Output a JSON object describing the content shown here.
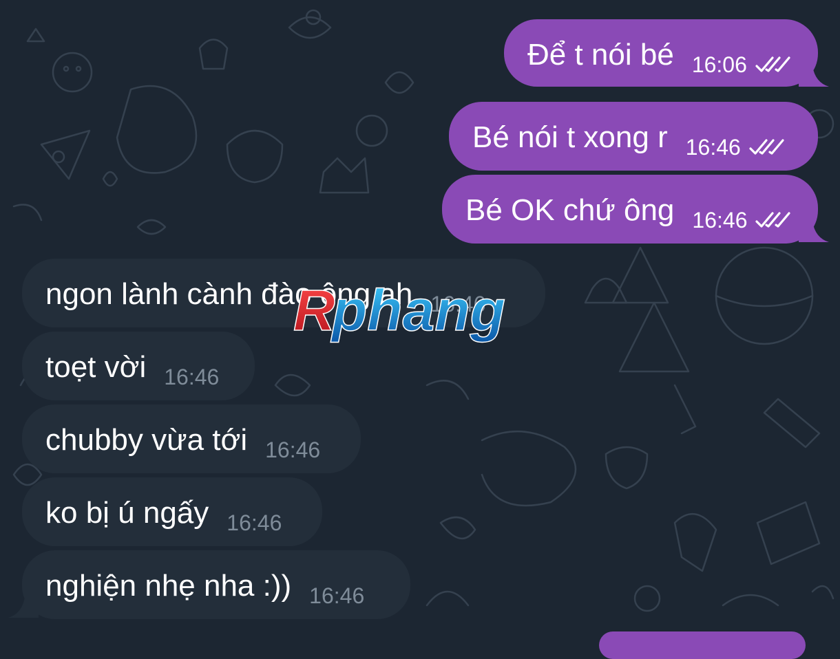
{
  "colors": {
    "background": "#1c2632",
    "outgoing_bubble": "#8a4ab6",
    "incoming_bubble": "#232e3a",
    "incoming_time": "#7f8c99"
  },
  "outgoing": [
    {
      "text": "Để t nói bé",
      "time": "16:06",
      "status": "read-double-check-icon"
    },
    {
      "text": "Bé nói t xong r",
      "time": "16:46",
      "status": "read-double-check-icon"
    },
    {
      "text": "Bé OK chứ ông",
      "time": "16:46",
      "status": "read-double-check-icon"
    }
  ],
  "incoming": [
    {
      "text": "ngon lành cành đào ông ah",
      "time": "16:46"
    },
    {
      "text": "toẹt vời",
      "time": "16:46"
    },
    {
      "text": "chubby vừa tới",
      "time": "16:46"
    },
    {
      "text": "ko bị ú ngấy",
      "time": "16:46"
    },
    {
      "text": "nghiện nhẹ nha :))",
      "time": "16:46"
    }
  ],
  "watermark": {
    "text": "Rphang"
  }
}
